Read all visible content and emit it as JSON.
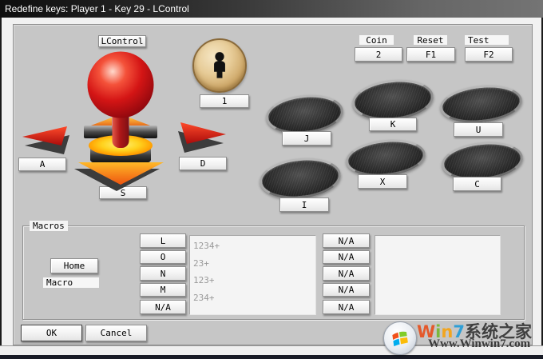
{
  "window": {
    "title": "Redefine keys: Player 1 - Key 29 - LControl"
  },
  "joystick": {
    "up_key": "LControl",
    "left_key": "A",
    "right_key": "D",
    "down_key": "S"
  },
  "player": {
    "label": "1"
  },
  "system_keys": {
    "coin_label": "Coin",
    "coin_value": "2",
    "reset_label": "Reset",
    "reset_value": "F1",
    "test_label": "Test",
    "test_value": "F2"
  },
  "action_buttons": [
    {
      "key": "J"
    },
    {
      "key": "K"
    },
    {
      "key": "U"
    },
    {
      "key": "I"
    },
    {
      "key": "X"
    },
    {
      "key": "C"
    }
  ],
  "macros": {
    "group_label": "Macros",
    "home_button": "Home",
    "macro_label": "Macro",
    "slots": [
      {
        "key": "L",
        "value": "1234+"
      },
      {
        "key": "O",
        "value": "23+"
      },
      {
        "key": "N",
        "value": "123+"
      },
      {
        "key": "M",
        "value": "234+"
      },
      {
        "key": "N/A",
        "value": ""
      }
    ],
    "na_column": [
      "N/A",
      "N/A",
      "N/A",
      "N/A",
      "N/A"
    ]
  },
  "footer": {
    "ok": "OK",
    "cancel": "Cancel"
  },
  "watermark": {
    "letters": [
      {
        "ch": "W",
        "color": "#e4582a"
      },
      {
        "ch": "i",
        "color": "#7cb83b"
      },
      {
        "ch": "n",
        "color": "#f2a51f"
      },
      {
        "ch": "7",
        "color": "#2f9fd6"
      }
    ],
    "brand": "系统之家",
    "url": "Www.Winwin7.com"
  },
  "colors": {
    "titlebar_left": "#0e0e0e",
    "titlebar_right": "#747474",
    "panel_bg": "#c6c6c6",
    "joystick_red": "#d41515",
    "arrow_orange": "#f07818",
    "coin_tan": "#d9b87a",
    "bottom_strip": "#181b26"
  }
}
